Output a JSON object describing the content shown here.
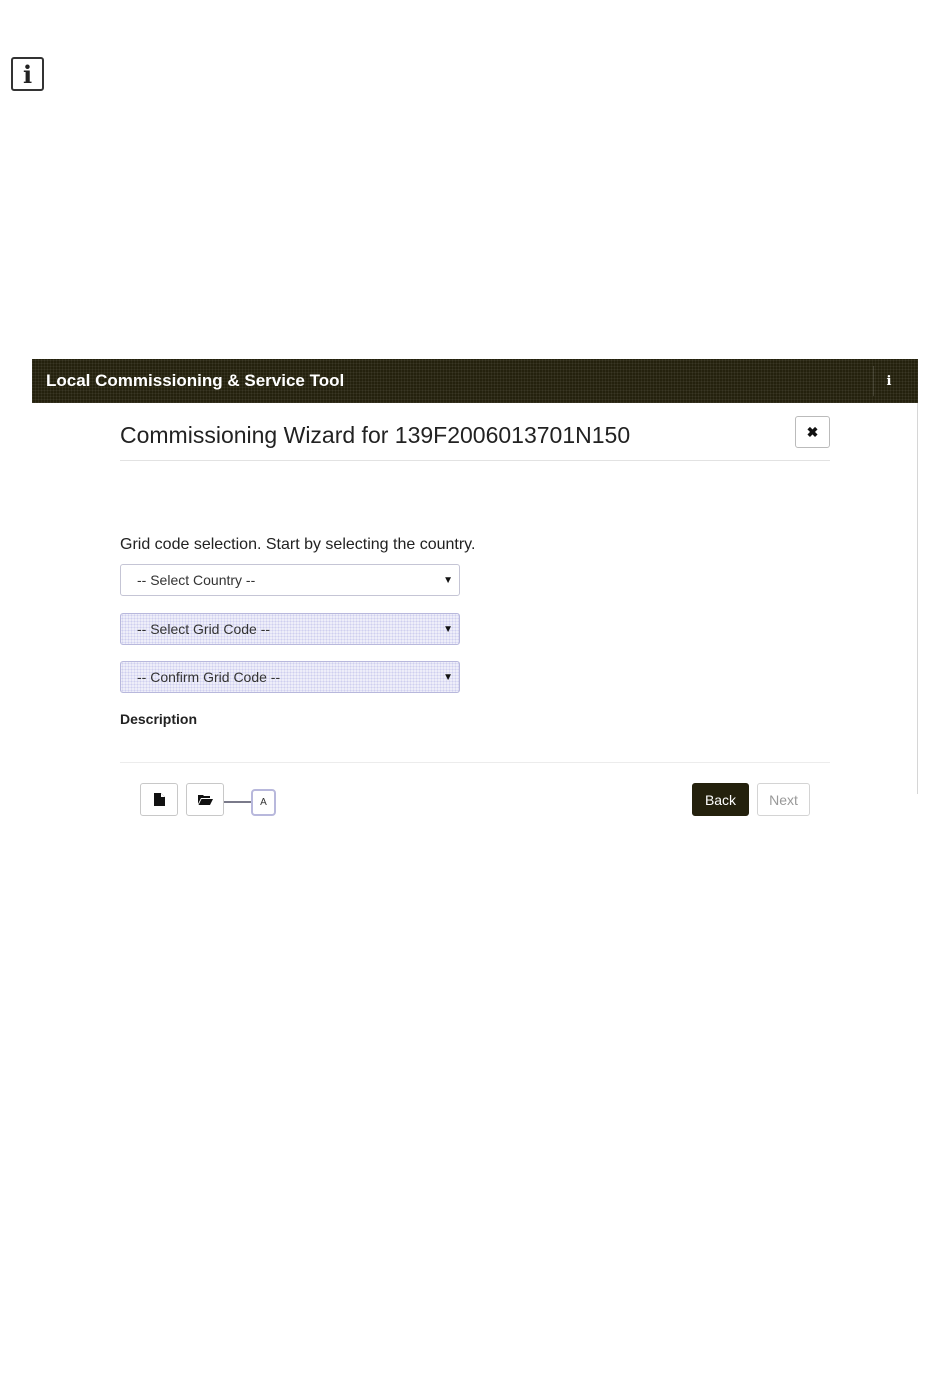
{
  "note_icon": "info-icon",
  "header": {
    "title": "Local Commissioning & Service Tool",
    "info_icon": "info-icon"
  },
  "wizard": {
    "title": "Commissioning Wizard for 139F2006013701N150",
    "close_icon": "close-icon",
    "prompt": "Grid code selection. Start by selecting the country.",
    "country_select": "-- Select Country --",
    "grid_code_select": "-- Select Grid Code --",
    "confirm_grid_code_select": "-- Confirm Grid Code --",
    "description_label": "Description",
    "new_file_icon": "file-icon",
    "open_folder_icon": "folder-open-icon",
    "callout_label": "A",
    "back_label": "Back",
    "next_label": "Next"
  },
  "colors": {
    "header_bg": "#24210d",
    "back_button_bg": "#24210d",
    "select_highlight": "#eeeef9"
  }
}
